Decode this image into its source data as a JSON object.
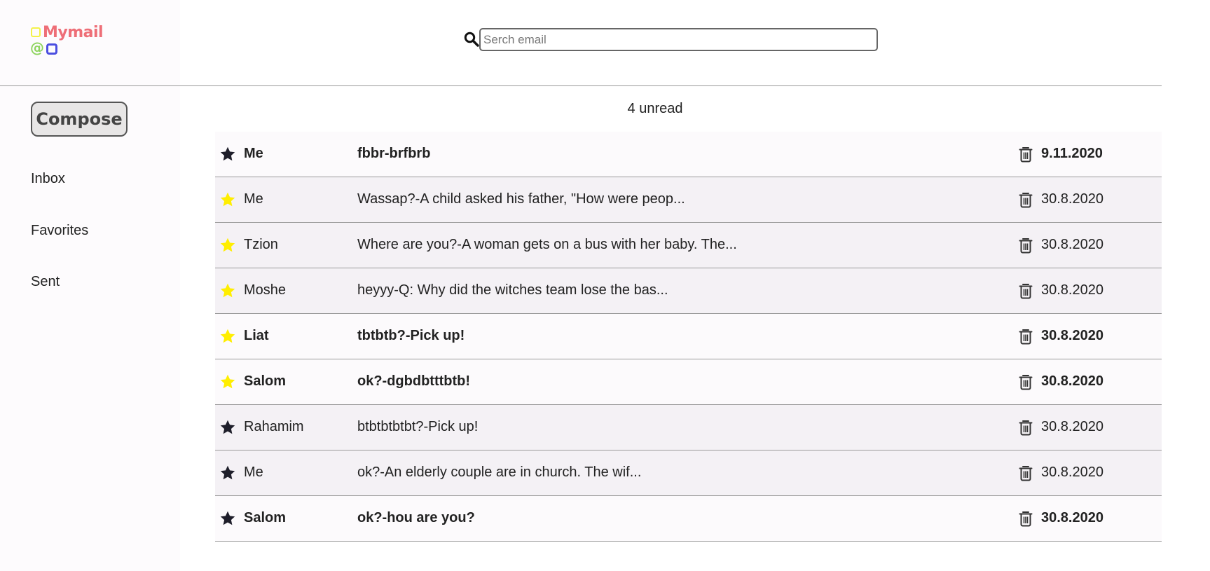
{
  "logo": {
    "name": "Mymail",
    "at": "@"
  },
  "search": {
    "placeholder": "Serch email",
    "value": ""
  },
  "compose_label": "Compose",
  "nav": [
    {
      "label": "Inbox"
    },
    {
      "label": "Favorites"
    },
    {
      "label": "Sent"
    }
  ],
  "unread_count": "4 unread",
  "colors": {
    "star_filled": "#ffee00",
    "star_empty": "#1e1e2a",
    "logo_text": "#ee6e77"
  },
  "emails": [
    {
      "sender": "Me",
      "subject": "fbbr-brfbrb",
      "date": "9.11.2020",
      "starred": false,
      "unread": true
    },
    {
      "sender": "Me",
      "subject": "Wassap?-A child asked his father, \"How were peop...",
      "date": "30.8.2020",
      "starred": true,
      "unread": false
    },
    {
      "sender": "Tzion",
      "subject": "Where are you?-A woman gets on a bus with her baby. The...",
      "date": "30.8.2020",
      "starred": true,
      "unread": false
    },
    {
      "sender": "Moshe",
      "subject": "heyyy-Q: Why did the witches team lose the bas...",
      "date": "30.8.2020",
      "starred": true,
      "unread": false
    },
    {
      "sender": "Liat",
      "subject": "tbtbtb?-Pick up!",
      "date": "30.8.2020",
      "starred": true,
      "unread": true
    },
    {
      "sender": "Salom",
      "subject": "ok?-dgbdbtttbtb!",
      "date": "30.8.2020",
      "starred": true,
      "unread": true
    },
    {
      "sender": "Rahamim",
      "subject": "btbtbtbtbt?-Pick up!",
      "date": "30.8.2020",
      "starred": false,
      "unread": false
    },
    {
      "sender": "Me",
      "subject": "ok?-An elderly couple are in church. The wif...",
      "date": "30.8.2020",
      "starred": false,
      "unread": false
    },
    {
      "sender": "Salom",
      "subject": "ok?-hou are you?",
      "date": "30.8.2020",
      "starred": false,
      "unread": true
    }
  ]
}
